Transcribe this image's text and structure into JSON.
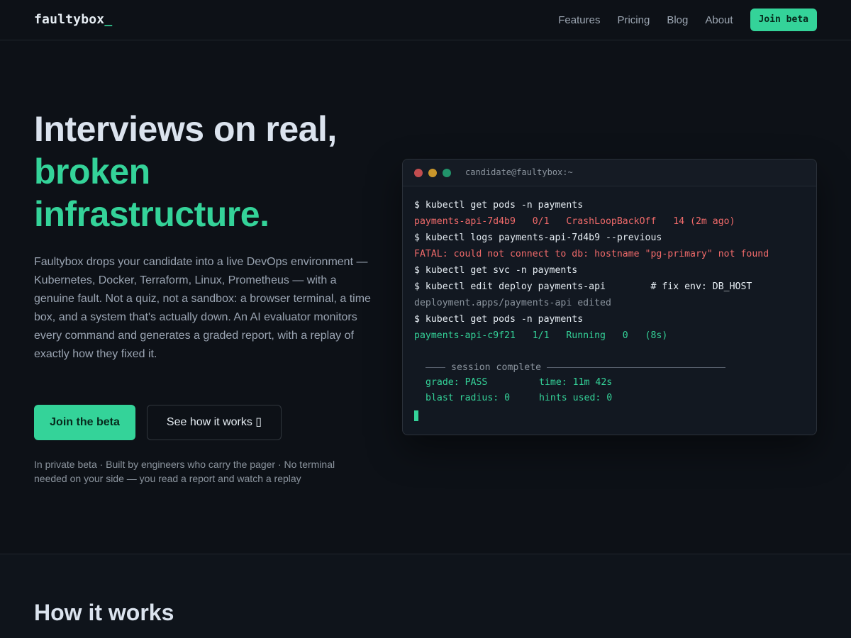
{
  "nav": {
    "logo_text": "faultybox",
    "logo_cursor": "_",
    "links": [
      "Features",
      "Pricing",
      "Blog",
      "About"
    ],
    "cta": "Join beta"
  },
  "hero": {
    "title_line1": "Interviews on real,",
    "title_line2": "broken",
    "title_line3": "infrastructure.",
    "subtitle": "Faultybox drops your candidate into a live DevOps environment — Kubernetes, Docker, Terraform, Linux, Prometheus — with a genuine fault. Not a quiz, not a sandbox: a browser terminal, a time box, and a system that's actually down. An AI evaluator monitors every command and generates a graded report, with a replay of exactly how they fixed it.",
    "primary_button": "Join the beta",
    "secondary_button": "See how it works ▯",
    "fineprint": "In private beta · Built by engineers who carry the pager · No terminal needed on your side — you read a report and watch a replay"
  },
  "terminal": {
    "title": "candidate@faultybox:~",
    "lines": [
      "$ kubectl get pods -n payments",
      "payments-api-7d4b9   0/1   CrashLoopBackOff   14 (2m ago)",
      "$ kubectl logs payments-api-7d4b9 --previous",
      "FATAL: could not connect to db: hostname \"pg-primary\" not found",
      "$ kubectl get svc -n payments",
      "$ kubectl edit deploy payments-api        # fix env: DB_HOST",
      "deployment.apps/payments-api edited",
      "$ kubectl get pods -n payments",
      "payments-api-c9f21   1/1   Running   0   (8s)"
    ],
    "session_label": "session complete",
    "summary": {
      "grade": "grade: PASS",
      "time": "time: 11m 42s",
      "blast": "blast radius: 0",
      "hints": "hints used: 0"
    }
  },
  "section2": {
    "title": "How it works"
  },
  "colors": {
    "accent": "#34d399",
    "background": "#0d1117",
    "error": "#f06a6a"
  }
}
